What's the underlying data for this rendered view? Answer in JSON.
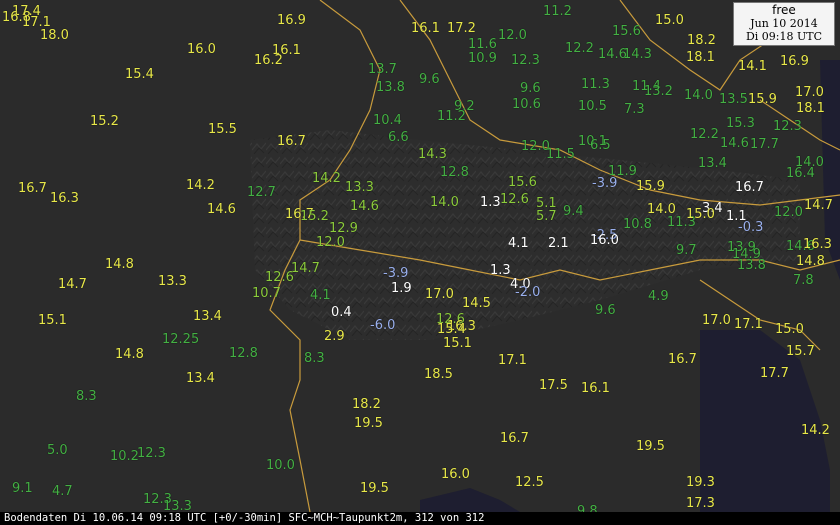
{
  "stamp": {
    "label": "free",
    "date": "Jun 10 2014",
    "time": "Di 09:18 UTC"
  },
  "footer": {
    "text": "Bodendaten Di 10.06.14 09:18 UTC [+0/-30min] SFC~MCH~Taupunkt2m, 312 von 312"
  },
  "colors": {
    "yellow": "#e8e84a",
    "green": "#44b044",
    "lightgreen": "#8ccc3c",
    "white": "#ffffff",
    "blue": "#9ab0ee",
    "border": "#c89b3c",
    "land": "#2b2b2b",
    "sea": "#1e1e30",
    "footer_bg": "#000000"
  },
  "labels": [
    {
      "t": "17.4",
      "c": "yellow"
    },
    {
      "t": "16.8",
      "c": "yellow"
    },
    {
      "t": "17.1",
      "c": "yellow"
    },
    {
      "t": "18.0",
      "c": "yellow"
    },
    {
      "t": "16.9",
      "c": "yellow"
    },
    {
      "t": "16.0",
      "c": "yellow"
    },
    {
      "t": "16.1",
      "c": "yellow"
    },
    {
      "t": "16.2",
      "c": "yellow"
    },
    {
      "t": "15.4",
      "c": "yellow"
    },
    {
      "t": "15.2",
      "c": "yellow"
    },
    {
      "t": "15.5",
      "c": "yellow"
    },
    {
      "t": "16.7",
      "c": "yellow"
    },
    {
      "t": "16.7",
      "c": "yellow"
    },
    {
      "t": "16.3",
      "c": "yellow"
    },
    {
      "t": "14.2",
      "c": "yellow"
    },
    {
      "t": "14.6",
      "c": "yellow"
    },
    {
      "t": "12.7",
      "c": "green"
    },
    {
      "t": "14.8",
      "c": "yellow"
    },
    {
      "t": "14.7",
      "c": "yellow"
    },
    {
      "t": "13.3",
      "c": "yellow"
    },
    {
      "t": "15.1",
      "c": "yellow"
    },
    {
      "t": "13.4",
      "c": "yellow"
    },
    {
      "t": "14.8",
      "c": "yellow"
    },
    {
      "t": "12.25",
      "c": "green"
    },
    {
      "t": "12.8",
      "c": "green"
    },
    {
      "t": "13.4",
      "c": "yellow"
    },
    {
      "t": "8.3",
      "c": "green"
    },
    {
      "t": "8.3",
      "c": "green"
    },
    {
      "t": "5.0",
      "c": "green"
    },
    {
      "t": "10.2",
      "c": "green"
    },
    {
      "t": "12.3",
      "c": "green"
    },
    {
      "t": "10.0",
      "c": "green"
    },
    {
      "t": "9.1",
      "c": "green"
    },
    {
      "t": "4.7",
      "c": "green"
    },
    {
      "t": "12.3",
      "c": "green"
    },
    {
      "t": "13.3",
      "c": "green"
    },
    {
      "t": "16.1",
      "c": "yellow"
    },
    {
      "t": "17.2",
      "c": "yellow"
    },
    {
      "t": "11.2",
      "c": "green"
    },
    {
      "t": "15.0",
      "c": "yellow"
    },
    {
      "t": "11.6",
      "c": "green"
    },
    {
      "t": "12.0",
      "c": "green"
    },
    {
      "t": "10.9",
      "c": "green"
    },
    {
      "t": "12.3",
      "c": "green"
    },
    {
      "t": "12.2",
      "c": "green"
    },
    {
      "t": "15.6",
      "c": "green"
    },
    {
      "t": "14.6",
      "c": "green"
    },
    {
      "t": "14.3",
      "c": "green"
    },
    {
      "t": "18.2",
      "c": "yellow"
    },
    {
      "t": "18.1",
      "c": "yellow"
    },
    {
      "t": "14.1",
      "c": "yellow"
    },
    {
      "t": "16.9",
      "c": "yellow"
    },
    {
      "t": "13.7",
      "c": "green"
    },
    {
      "t": "13.8",
      "c": "green"
    },
    {
      "t": "9.6",
      "c": "green"
    },
    {
      "t": "9.6",
      "c": "green"
    },
    {
      "t": "11.3",
      "c": "green"
    },
    {
      "t": "11.4",
      "c": "green"
    },
    {
      "t": "13.2",
      "c": "green"
    },
    {
      "t": "14.0",
      "c": "green"
    },
    {
      "t": "13.5",
      "c": "green"
    },
    {
      "t": "15.9",
      "c": "yellow"
    },
    {
      "t": "17.0",
      "c": "yellow"
    },
    {
      "t": "10.4",
      "c": "green"
    },
    {
      "t": "11.2",
      "c": "green"
    },
    {
      "t": "9.2",
      "c": "green"
    },
    {
      "t": "10.6",
      "c": "green"
    },
    {
      "t": "10.5",
      "c": "green"
    },
    {
      "t": "7.3",
      "c": "green"
    },
    {
      "t": "18.1",
      "c": "yellow"
    },
    {
      "t": "6.6",
      "c": "green"
    },
    {
      "t": "12.0",
      "c": "green"
    },
    {
      "t": "11.5",
      "c": "green"
    },
    {
      "t": "10.1",
      "c": "green"
    },
    {
      "t": "6.5",
      "c": "green"
    },
    {
      "t": "12.2",
      "c": "green"
    },
    {
      "t": "14.6",
      "c": "green"
    },
    {
      "t": "17.7",
      "c": "green"
    },
    {
      "t": "15.3",
      "c": "green"
    },
    {
      "t": "12.3",
      "c": "green"
    },
    {
      "t": "14.3",
      "c": "lightgreen"
    },
    {
      "t": "12.8",
      "c": "green"
    },
    {
      "t": "15.6",
      "c": "lightgreen"
    },
    {
      "t": "-3.9",
      "c": "blue"
    },
    {
      "t": "11.9",
      "c": "green"
    },
    {
      "t": "13.4",
      "c": "green"
    },
    {
      "t": "16.7",
      "c": "white"
    },
    {
      "t": "16.4",
      "c": "green"
    },
    {
      "t": "14.0",
      "c": "green"
    },
    {
      "t": "14.2",
      "c": "lightgreen"
    },
    {
      "t": "13.3",
      "c": "lightgreen"
    },
    {
      "t": "14.6",
      "c": "lightgreen"
    },
    {
      "t": "14.0",
      "c": "lightgreen"
    },
    {
      "t": "1.3",
      "c": "white"
    },
    {
      "t": "5.1",
      "c": "lightgreen"
    },
    {
      "t": "12.6",
      "c": "lightgreen"
    },
    {
      "t": "15.9",
      "c": "yellow"
    },
    {
      "t": "14.0",
      "c": "yellow"
    },
    {
      "t": "3.4",
      "c": "white"
    },
    {
      "t": "1.1",
      "c": "white"
    },
    {
      "t": "12.0",
      "c": "green"
    },
    {
      "t": "14.7",
      "c": "yellow"
    },
    {
      "t": "16.7",
      "c": "yellow"
    },
    {
      "t": "12.9",
      "c": "lightgreen"
    },
    {
      "t": "5.7",
      "c": "lightgreen"
    },
    {
      "t": "9.4",
      "c": "green"
    },
    {
      "t": "10.8",
      "c": "green"
    },
    {
      "t": "11.3",
      "c": "green"
    },
    {
      "t": "15.0",
      "c": "yellow"
    },
    {
      "t": "-0.3",
      "c": "blue"
    },
    {
      "t": "-2.5",
      "c": "blue"
    },
    {
      "t": "16.0",
      "c": "white"
    },
    {
      "t": "12.0",
      "c": "lightgreen"
    },
    {
      "t": "2.1",
      "c": "white"
    },
    {
      "t": "4.1",
      "c": "white"
    },
    {
      "t": "9.7",
      "c": "green"
    },
    {
      "t": "13.9",
      "c": "green"
    },
    {
      "t": "14.9",
      "c": "green"
    },
    {
      "t": "14.6",
      "c": "green"
    },
    {
      "t": "13.8",
      "c": "green"
    },
    {
      "t": "14.7",
      "c": "lightgreen"
    },
    {
      "t": "-3.9",
      "c": "blue"
    },
    {
      "t": "1.9",
      "c": "white"
    },
    {
      "t": "17.0",
      "c": "yellow"
    },
    {
      "t": "1.3",
      "c": "white"
    },
    {
      "t": "4.0",
      "c": "white"
    },
    {
      "t": "-2.0",
      "c": "blue"
    },
    {
      "t": "14.5",
      "c": "yellow"
    },
    {
      "t": "9.6",
      "c": "green"
    },
    {
      "t": "4.9",
      "c": "green"
    },
    {
      "t": "7.8",
      "c": "green"
    },
    {
      "t": "0.4",
      "c": "white"
    },
    {
      "t": "-6.0",
      "c": "blue"
    },
    {
      "t": "12.6",
      "c": "lightgreen"
    },
    {
      "t": "16.3",
      "c": "yellow"
    },
    {
      "t": "15.4",
      "c": "yellow"
    },
    {
      "t": "15.1",
      "c": "yellow"
    },
    {
      "t": "2.9",
      "c": "yellow"
    },
    {
      "t": "17.0",
      "c": "yellow"
    },
    {
      "t": "17.1",
      "c": "yellow"
    },
    {
      "t": "15.0",
      "c": "yellow"
    },
    {
      "t": "16.7",
      "c": "yellow"
    },
    {
      "t": "15.7",
      "c": "yellow"
    },
    {
      "t": "17.1",
      "c": "yellow"
    },
    {
      "t": "18.5",
      "c": "yellow"
    },
    {
      "t": "17.5",
      "c": "yellow"
    },
    {
      "t": "16.1",
      "c": "yellow"
    },
    {
      "t": "17.7",
      "c": "yellow"
    },
    {
      "t": "18.2",
      "c": "yellow"
    },
    {
      "t": "19.5",
      "c": "yellow"
    },
    {
      "t": "16.7",
      "c": "yellow"
    },
    {
      "t": "19.5",
      "c": "yellow"
    },
    {
      "t": "14.2",
      "c": "yellow"
    },
    {
      "t": "16.0",
      "c": "yellow"
    },
    {
      "t": "12.5",
      "c": "yellow"
    },
    {
      "t": "19.5",
      "c": "yellow"
    },
    {
      "t": "19.3",
      "c": "yellow"
    },
    {
      "t": "17.3",
      "c": "yellow"
    },
    {
      "t": "9.8",
      "c": "green"
    },
    {
      "t": "16.3",
      "c": "yellow"
    },
    {
      "t": "14.8",
      "c": "yellow"
    },
    {
      "t": "12.6",
      "c": "lightgreen"
    },
    {
      "t": "10.7",
      "c": "lightgreen"
    },
    {
      "t": "4.1",
      "c": "green"
    },
    {
      "t": "15.2",
      "c": "lightgreen"
    }
  ]
}
